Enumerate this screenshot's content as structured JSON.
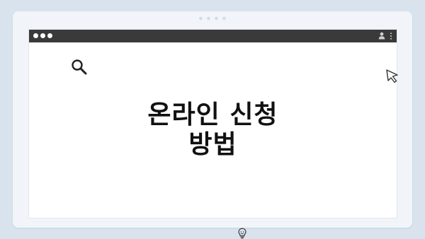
{
  "window": {
    "title_lines": [
      "온라인 신청",
      "방법"
    ]
  },
  "icons": {
    "search": "search-icon",
    "cursor": "cursor-icon",
    "lightbulb": "lightbulb-icon",
    "user": "user-icon",
    "menu": "kebab-menu-icon"
  },
  "colors": {
    "background": "#d9e3ee",
    "frame": "#f1f4f8",
    "titlebar": "#3a3a3a",
    "text": "#111111"
  }
}
